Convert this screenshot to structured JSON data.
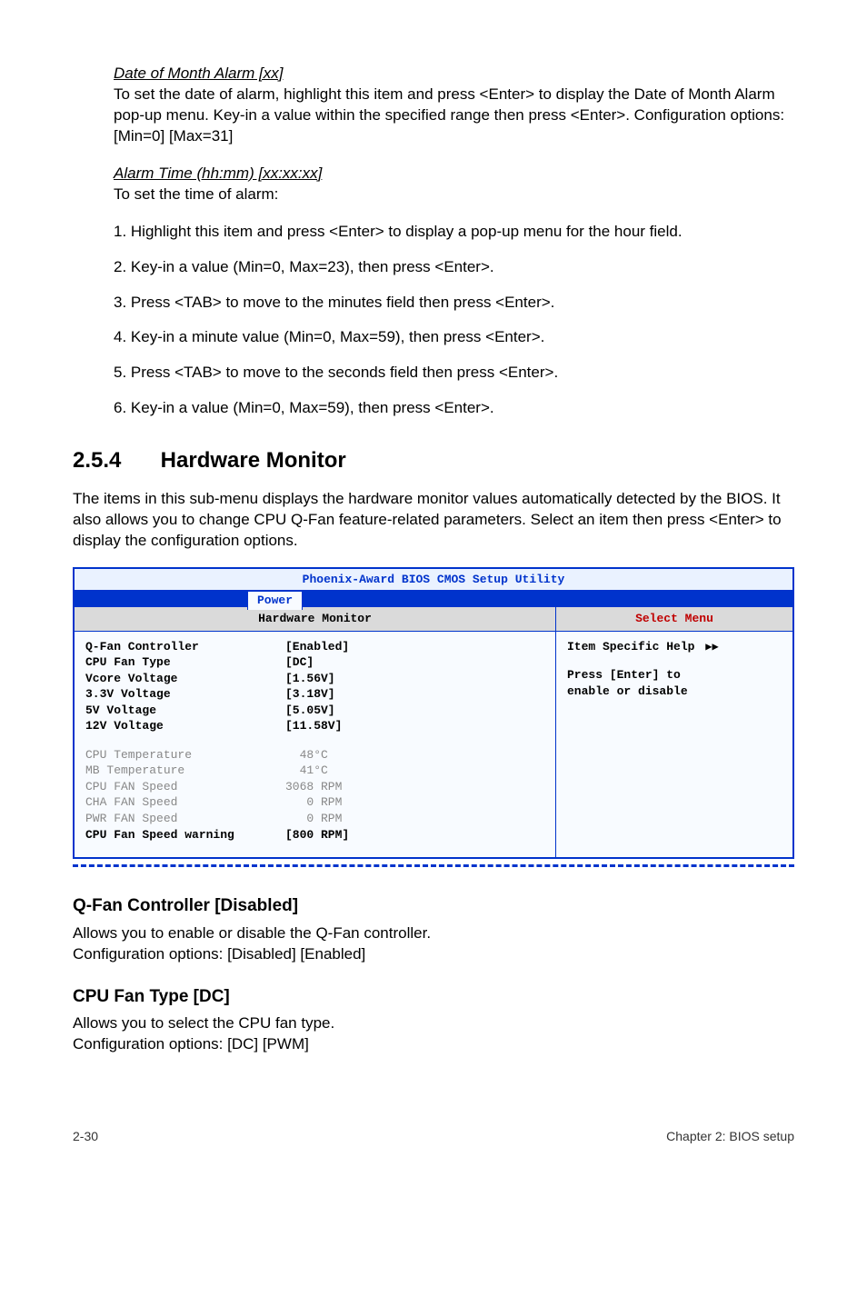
{
  "dateAlarm": {
    "heading": "Date of Month Alarm [xx]",
    "para": "To set the date of alarm, highlight this item and press <Enter> to display the Date of Month Alarm pop-up menu. Key-in a value within the specified range then press <Enter>. Configuration options: [Min=0] [Max=31]"
  },
  "alarmTime": {
    "heading": "Alarm Time (hh:mm) [xx:xx:xx]",
    "para": "To set the time of alarm:"
  },
  "steps": [
    "1. Highlight this item and press <Enter> to display a pop-up menu for the hour field.",
    "2. Key-in a value (Min=0, Max=23), then press <Enter>.",
    "3. Press <TAB> to move to the minutes field then press <Enter>.",
    "4. Key-in a minute value (Min=0, Max=59), then press <Enter>.",
    "5. Press <TAB> to move to the seconds field then press <Enter>.",
    "6. Key-in a value (Min=0, Max=59), then press <Enter>."
  ],
  "section": {
    "number": "2.5.4",
    "title": "Hardware Monitor",
    "intro": "The items in this sub-menu displays the hardware monitor values automatically detected by the BIOS. It also allows you to change CPU Q-Fan feature-related parameters. Select an item then press <Enter> to display the configuration options."
  },
  "bios": {
    "title": "Phoenix-Award BIOS CMOS Setup Utility",
    "tab": "Power",
    "panelTitle": "Hardware Monitor",
    "helpTitle": "Select Menu",
    "helpItem": "Item Specific Help",
    "helpText1": "Press [Enter] to",
    "helpText2": "enable or disable",
    "rowsStrong": [
      {
        "label": "Q-Fan Controller",
        "value": "[Enabled]"
      },
      {
        "label": "CPU Fan Type",
        "value": "[DC]"
      },
      {
        "label": "Vcore Voltage",
        "value": "[1.56V]"
      },
      {
        "label": "3.3V Voltage",
        "value": "[3.18V]"
      },
      {
        "label": "5V Voltage",
        "value": "[5.05V]"
      },
      {
        "label": "12V Voltage",
        "value": "[11.58V]"
      }
    ],
    "rowsMuted": [
      {
        "label": "CPU Temperature",
        "value": "  48°C"
      },
      {
        "label": "MB Temperature",
        "value": "  41°C"
      },
      {
        "label": "CPU FAN Speed",
        "value": "3068 RPM"
      },
      {
        "label": "CHA FAN Speed",
        "value": "   0 RPM"
      },
      {
        "label": "PWR FAN Speed",
        "value": "   0 RPM"
      }
    ],
    "lastRow": {
      "label": "CPU Fan Speed warning",
      "value": "[800 RPM]"
    }
  },
  "qfan": {
    "heading": "Q-Fan Controller [Disabled]",
    "line1": "Allows you to enable or disable the Q-Fan controller.",
    "line2": "Configuration options: [Disabled] [Enabled]"
  },
  "cpufan": {
    "heading": "CPU Fan Type [DC]",
    "line1": "Allows you to select the CPU fan type.",
    "line2": "Configuration options: [DC] [PWM]"
  },
  "footer": {
    "left": "2-30",
    "right": "Chapter 2: BIOS setup"
  }
}
